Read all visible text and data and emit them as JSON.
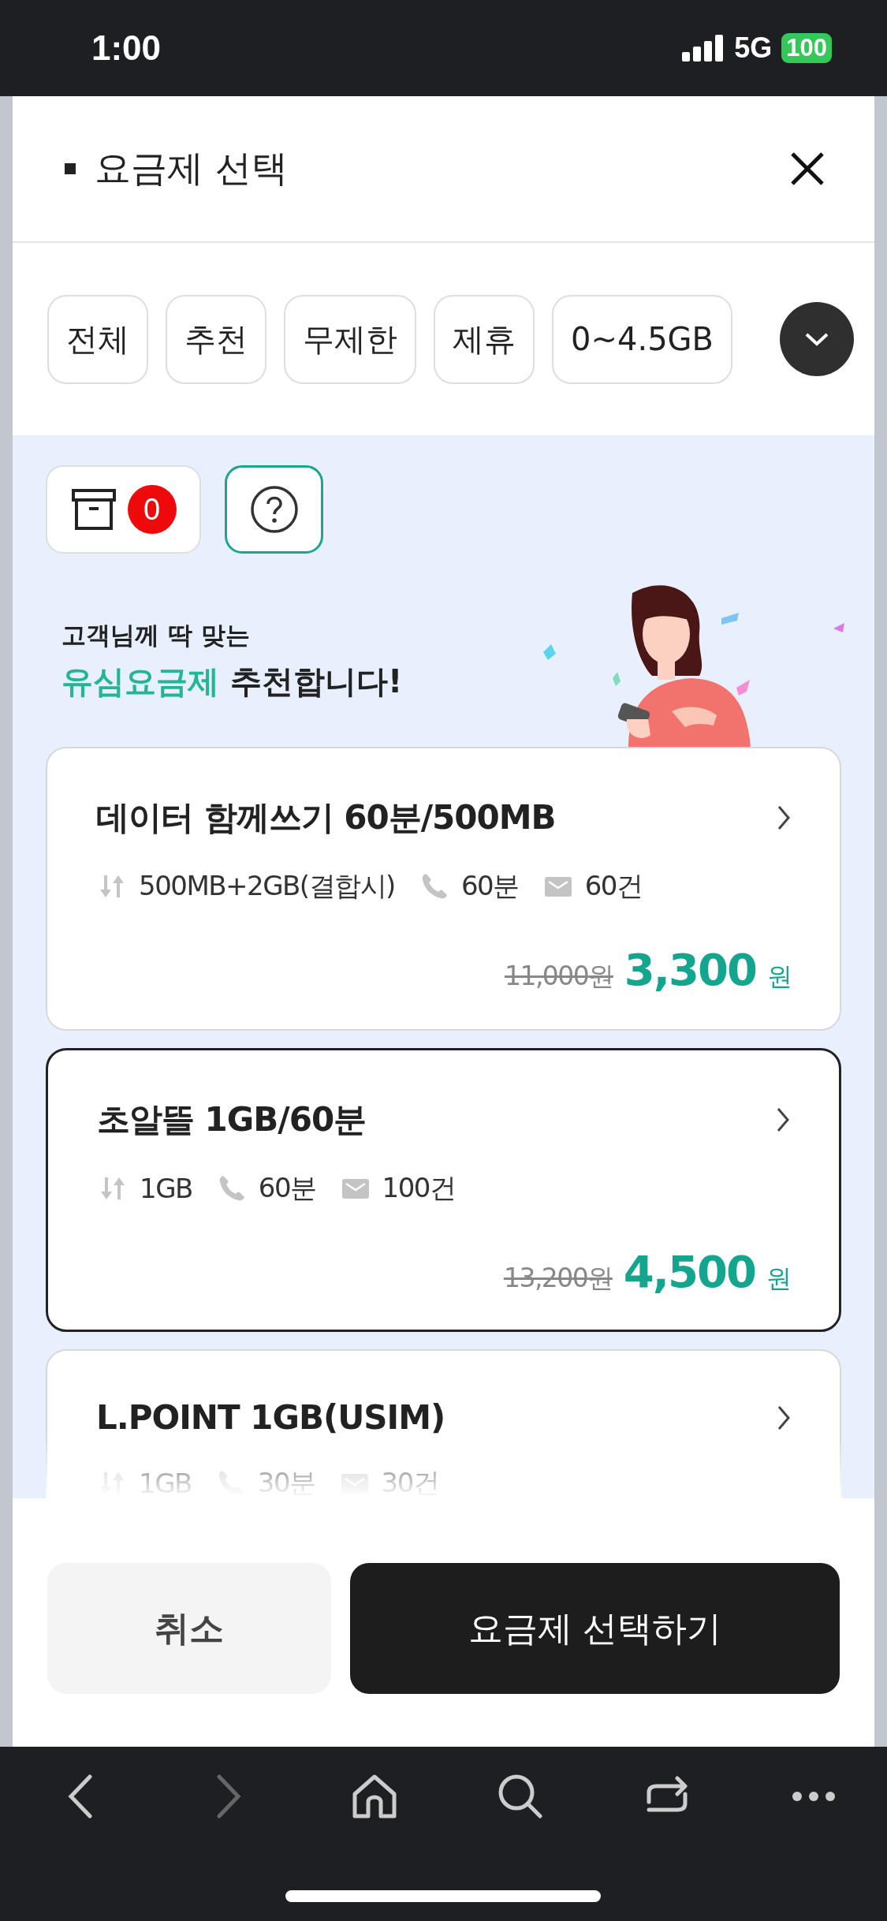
{
  "status_bar": {
    "time": "1:00",
    "network": "5G",
    "battery": "100"
  },
  "header": {
    "title": "요금제 선택"
  },
  "filter_chips": [
    {
      "label": "전체"
    },
    {
      "label": "추천"
    },
    {
      "label": "무제한"
    },
    {
      "label": "제휴"
    },
    {
      "label": "0~4.5GB"
    }
  ],
  "tools": {
    "saved_count": "0"
  },
  "banner": {
    "line1": "고객님께 딱 맞는",
    "highlight": "유심요금제",
    "rest": "추천합니다!"
  },
  "plans": [
    {
      "name": "데이터 함께쓰기 60분/500MB",
      "selected": false,
      "features": [
        {
          "kind": "data",
          "text": "500MB+2GB(결합시)"
        },
        {
          "kind": "voice",
          "text": "60분"
        },
        {
          "kind": "sms",
          "text": "60건"
        }
      ],
      "original_price": "11,000",
      "original_unit": "원",
      "price": "3,300",
      "unit": "원"
    },
    {
      "name": "초알뜰 1GB/60분",
      "selected": true,
      "features": [
        {
          "kind": "data",
          "text": "1GB"
        },
        {
          "kind": "voice",
          "text": "60분"
        },
        {
          "kind": "sms",
          "text": "100건"
        }
      ],
      "original_price": "13,200",
      "original_unit": "원",
      "price": "4,500",
      "unit": "원"
    },
    {
      "name": "L.POINT 1GB(USIM)",
      "selected": false,
      "features": [
        {
          "kind": "data",
          "text": "1GB"
        },
        {
          "kind": "voice",
          "text": "30분"
        },
        {
          "kind": "sms",
          "text": "30건"
        }
      ]
    }
  ],
  "buttons": {
    "cancel": "취소",
    "confirm": "요금제 선택하기"
  }
}
